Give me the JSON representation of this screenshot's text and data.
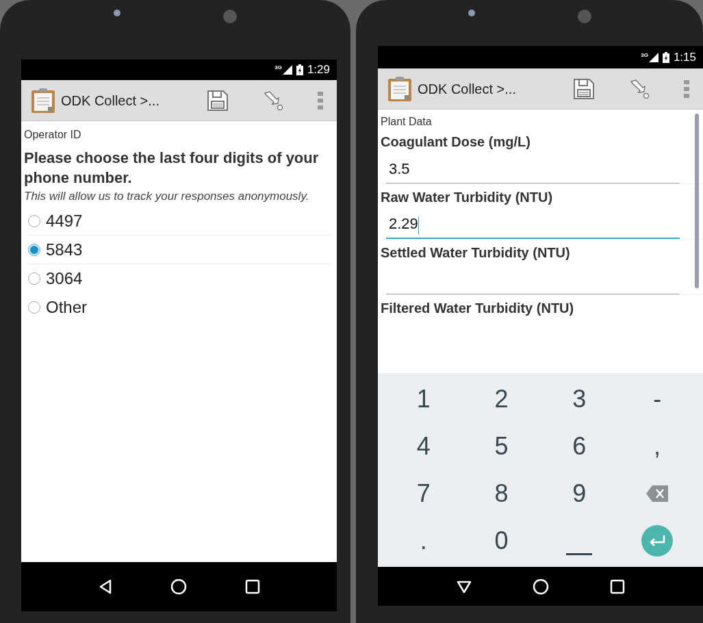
{
  "phones": [
    {
      "status_bar": {
        "network": "3G",
        "time": "1:29"
      },
      "toolbar": {
        "title": "ODK Collect >..."
      },
      "screen": {
        "kind": "select",
        "group_label": "Operator ID",
        "question": "Please choose the last four digits of your phone number.",
        "hint": "This will allow us to track your responses anonymously.",
        "options": [
          {
            "label": "4497",
            "selected": false
          },
          {
            "label": "5843",
            "selected": true
          },
          {
            "label": "3064",
            "selected": false
          },
          {
            "label": "Other",
            "selected": false
          }
        ]
      }
    },
    {
      "status_bar": {
        "network": "3G",
        "time": "1:15"
      },
      "toolbar": {
        "title": "ODK Collect >..."
      },
      "screen": {
        "kind": "numeric",
        "group_label": "Plant Data",
        "fields": [
          {
            "label": "Coagulant Dose (mg/L)",
            "value": "3.5",
            "focused": false
          },
          {
            "label": "Raw Water Turbidity (NTU)",
            "value": "2.29",
            "focused": true
          },
          {
            "label": "Settled Water Turbidity (NTU)",
            "focused": false
          },
          {
            "label": "Filtered Water Turbidity (NTU)"
          }
        ],
        "keyboard": [
          {
            "kind": "char",
            "label": "1"
          },
          {
            "kind": "char",
            "label": "2"
          },
          {
            "kind": "char",
            "label": "3"
          },
          {
            "kind": "char",
            "label": "-"
          },
          {
            "kind": "char",
            "label": "4"
          },
          {
            "kind": "char",
            "label": "5"
          },
          {
            "kind": "char",
            "label": "6"
          },
          {
            "kind": "char",
            "label": ","
          },
          {
            "kind": "char",
            "label": "7"
          },
          {
            "kind": "char",
            "label": "8"
          },
          {
            "kind": "char",
            "label": "9"
          },
          {
            "kind": "backspace"
          },
          {
            "kind": "char",
            "label": "."
          },
          {
            "kind": "char",
            "label": "0"
          },
          {
            "kind": "space"
          },
          {
            "kind": "enter"
          }
        ]
      }
    }
  ]
}
